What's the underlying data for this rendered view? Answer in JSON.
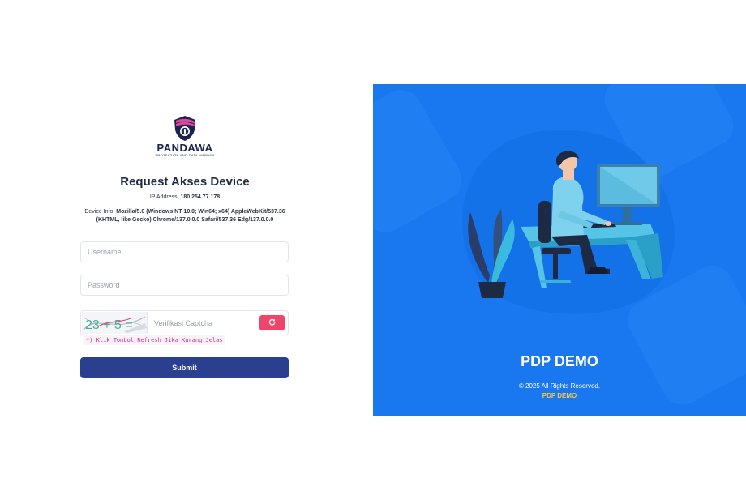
{
  "logo": {
    "word": "PANDAWA",
    "tagline": "PROTECTION AND DATA WARDEN"
  },
  "heading": {
    "title": "Request Akses Device",
    "ip_label": "IP Address:",
    "ip_value": "180.254.77.178",
    "device_label": "Device Info:",
    "device_value": "Mozilla/5.0 (Windows NT 10.0; Win64; x64) AppleWebKit/537.36 (KHTML, like Gecko) Chrome/137.0.0.0 Safari/537.36 Edg/137.0.0.0"
  },
  "form": {
    "username_placeholder": "Username",
    "username_value": "",
    "password_placeholder": "Password",
    "password_value": "",
    "captcha_text": "23 + 5 =",
    "captcha_placeholder": "Verifikasi Captcha",
    "captcha_value": "",
    "refresh_icon": "refresh-icon",
    "hint": "*) Klik Tombol Refresh Jika Kurang Jelas",
    "submit_label": "Submit"
  },
  "panel": {
    "brand": "PDP DEMO",
    "copyright": "© 2025 All Rights Reserved.",
    "copyright_link": "PDP DEMO",
    "illustration": "person-at-desk-illustration"
  },
  "colors": {
    "panel_bg": "#1978f0",
    "submit_bg": "#2a3f8f",
    "refresh_bg": "#f0456a",
    "hint_color": "#c2338a",
    "link_color": "#f5c84a"
  }
}
